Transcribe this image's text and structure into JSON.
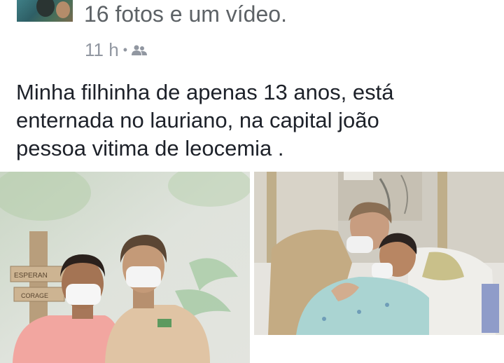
{
  "post": {
    "headline": "16 fotos e um vídeo.",
    "time": "11 h",
    "separator": "•",
    "audience_icon": "friends-icon",
    "text_lines": [
      "Minha filhinha de apenas 13 anos, está",
      "enternada no lauriano, na capital joão",
      "pessoa vitima de leocemia ."
    ]
  },
  "photos": {
    "left": {
      "sign_top": "ESPERAN",
      "sign_bottom": "CORAGE"
    },
    "right": {}
  }
}
